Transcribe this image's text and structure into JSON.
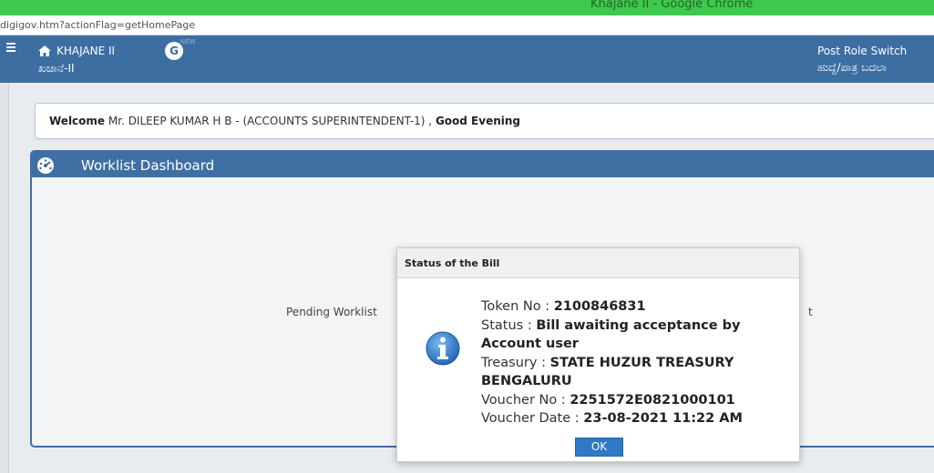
{
  "browser": {
    "window_title": "Khajane II - Google Chrome",
    "url": "digigov.htm?actionFlag=getHomePage"
  },
  "header": {
    "app_name": "KHAJANE II",
    "app_name_kannada": "ಖಜಾನೆ-II",
    "badge_letter": "G",
    "badge_new": "NEW",
    "role_switch": "Post Role Switch",
    "role_switch_kannada": "ಹುದ್ದೆ/ಪಾತ್ರ ಬದಲಾ"
  },
  "welcome": {
    "prefix": "Welcome",
    "user": " Mr. DILEEP KUMAR H B - (ACCOUNTS SUPERINTENDENT-1) , ",
    "greeting": "Good Evening"
  },
  "dashboard": {
    "title": "Worklist Dashboard",
    "pending_text": "Pending Worklist",
    "pending_tail": "t"
  },
  "modal": {
    "title": "Status of the Bill",
    "token_label": "Token No : ",
    "token_value": "2100846831",
    "status_label": "Status : ",
    "status_value": "Bill awaiting acceptance by Account user",
    "treasury_label": "Treasury : ",
    "treasury_value": "STATE HUZUR TREASURY BENGALURU",
    "voucher_no_label": "Voucher No : ",
    "voucher_no_value": "2251572E0821000101",
    "voucher_date_label": "Voucher Date : ",
    "voucher_date_value": "23-08-2021 11:22 AM",
    "ok_label": "OK"
  },
  "icons": {
    "menu": "hamburger-menu-icon",
    "home": "home-icon",
    "dashboard": "dashboard-gauge-icon",
    "info": "info-icon"
  },
  "colors": {
    "chrome_bar": "#3ec94d",
    "header": "#3c6ea2",
    "panel_header": "#3f6fa3",
    "button": "#2f79c6"
  }
}
